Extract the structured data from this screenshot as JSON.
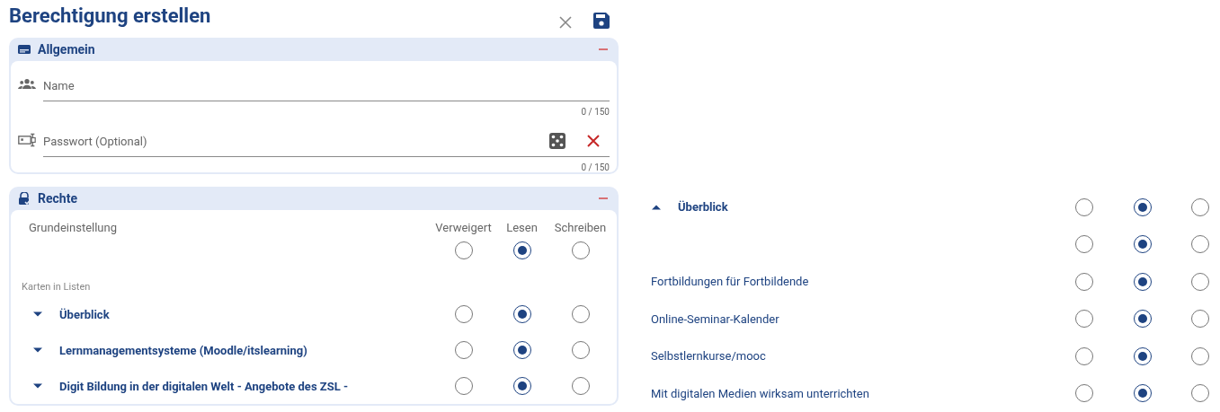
{
  "title": "Berechtigung erstellen",
  "sections": [
    {
      "title": "Allgemein",
      "expanded": true
    },
    {
      "title": "Rechte",
      "expanded": true
    }
  ],
  "fields": [
    {
      "kind": "text",
      "placeholder": "Name",
      "counter": "0 / 150"
    },
    {
      "kind": "password",
      "placeholder": "Passwort (Optional)",
      "counter": "0 / 150"
    }
  ],
  "rights": {
    "columns": [
      "Verweigert",
      "Lesen",
      "Schreiben"
    ],
    "default_label": "Grundeinstellung",
    "default_options": [
      {
        "selected": false
      },
      {
        "selected": true
      },
      {
        "selected": false
      }
    ],
    "group_label": "Karten in Listen",
    "rows": [
      {
        "kind": "group",
        "label": "Überblick",
        "expanded": false,
        "options": [
          {
            "selected": false
          },
          {
            "selected": true
          },
          {
            "selected": false
          }
        ]
      },
      {
        "kind": "group",
        "label": "Lernmanagementsysteme (Moodle/itslearning)",
        "expanded": false,
        "options": [
          {
            "selected": false
          },
          {
            "selected": true
          },
          {
            "selected": false
          }
        ]
      },
      {
        "kind": "group",
        "label": "Digit Bildung in der digitalen Welt - Angebote des ZSL -",
        "expanded": false,
        "options": [
          {
            "selected": false
          },
          {
            "selected": true
          },
          {
            "selected": false
          }
        ]
      }
    ]
  },
  "detail_rows": [
    {
      "kind": "group",
      "label": "Überblick",
      "expanded": true,
      "options": [
        {
          "selected": false
        },
        {
          "selected": true
        },
        {
          "selected": false
        }
      ]
    },
    {
      "kind": "item",
      "options": [
        {
          "selected": false
        },
        {
          "selected": true
        },
        {
          "selected": false
        }
      ]
    },
    {
      "kind": "item",
      "label": "Fortbildungen für Fortbildende",
      "options": [
        {
          "selected": false
        },
        {
          "selected": true
        },
        {
          "selected": false
        }
      ]
    },
    {
      "kind": "item",
      "label": "Online-Seminar-Kalender",
      "options": [
        {
          "selected": false
        },
        {
          "selected": true
        },
        {
          "selected": false
        }
      ]
    },
    {
      "kind": "item",
      "label": "Selbstlernkurse/mooc",
      "options": [
        {
          "selected": false
        },
        {
          "selected": true
        },
        {
          "selected": false
        }
      ]
    },
    {
      "kind": "item",
      "label": "Mit digitalen Medien wirksam unterrichten",
      "options": [
        {
          "selected": false
        },
        {
          "selected": true
        },
        {
          "selected": false
        }
      ]
    }
  ]
}
